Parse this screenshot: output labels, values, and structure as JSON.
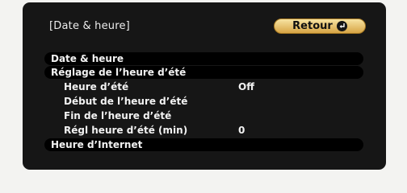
{
  "header": {
    "title": "[Date & heure]",
    "back_label": "Retour"
  },
  "menu": {
    "items": [
      {
        "label": "Date & heure",
        "value": ""
      },
      {
        "label": "Réglage de l’heure d’été",
        "value": ""
      },
      {
        "label": "Heure d’été",
        "value": "Off"
      },
      {
        "label": "Début de l’heure d’été",
        "value": ""
      },
      {
        "label": "Fin de l’heure d’été",
        "value": ""
      },
      {
        "label": "Régl heure d’été (min)",
        "value": "0"
      },
      {
        "label": "Heure d’Internet",
        "value": ""
      }
    ]
  },
  "colors": {
    "panel": "#161616",
    "row_highlight": "#000000",
    "button": "#e6bd6a",
    "text": "#f2f2f2"
  },
  "icons": {
    "back": "enter-return-icon"
  }
}
